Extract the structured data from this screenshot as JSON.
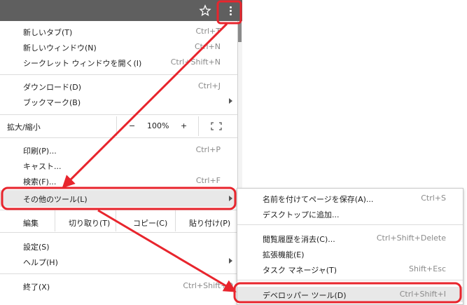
{
  "toolbar": {
    "star_icon": "star-icon",
    "menu_icon": "three-dots-icon"
  },
  "menu": {
    "items_top": [
      {
        "label": "新しいタブ(T)",
        "shortcut": "Ctrl+T"
      },
      {
        "label": "新しいウィンドウ(N)",
        "shortcut": "Ctrl+N"
      },
      {
        "label": "シークレット ウィンドウを開く(I)",
        "shortcut": "Ctrl+Shift+N"
      }
    ],
    "download": {
      "label": "ダウンロード(D)",
      "shortcut": "Ctrl+J"
    },
    "bookmarks": {
      "label": "ブックマーク(B)"
    },
    "zoom": {
      "label": "拡大/縮小",
      "minus": "−",
      "value": "100%",
      "plus": "+"
    },
    "print": {
      "label": "印刷(P)...",
      "shortcut": "Ctrl+P"
    },
    "cast": {
      "label": "キャスト..."
    },
    "find": {
      "label": "検索(F)...",
      "shortcut": "Ctrl+F"
    },
    "more_tools": {
      "label": "その他のツール(L)"
    },
    "edit": {
      "label": "編集",
      "cut": "切り取り(T)",
      "copy": "コピー(C)",
      "paste": "貼り付け(P)"
    },
    "settings": {
      "label": "設定(S)"
    },
    "help": {
      "label": "ヘルプ(H)"
    },
    "exit": {
      "label": "終了(X)",
      "shortcut": "Ctrl+Shift+Q"
    }
  },
  "submenu": {
    "save_page": {
      "label": "名前を付けてページを保存(A)...",
      "shortcut": "Ctrl+S"
    },
    "add_desktop": {
      "label": "デスクトップに追加..."
    },
    "clear_history": {
      "label": "閲覧履歴を消去(C)...",
      "shortcut": "Ctrl+Shift+Delete"
    },
    "extensions": {
      "label": "拡張機能(E)"
    },
    "task_manager": {
      "label": "タスク マネージャ(T)",
      "shortcut": "Shift+Esc"
    },
    "dev_tools": {
      "label": "デベロッパー ツール(D)",
      "shortcut": "Ctrl+Shift+I"
    }
  },
  "colors": {
    "annotation": "#e8252d",
    "topbar": "#5f5f5f",
    "highlight": "#e8e8e8"
  }
}
